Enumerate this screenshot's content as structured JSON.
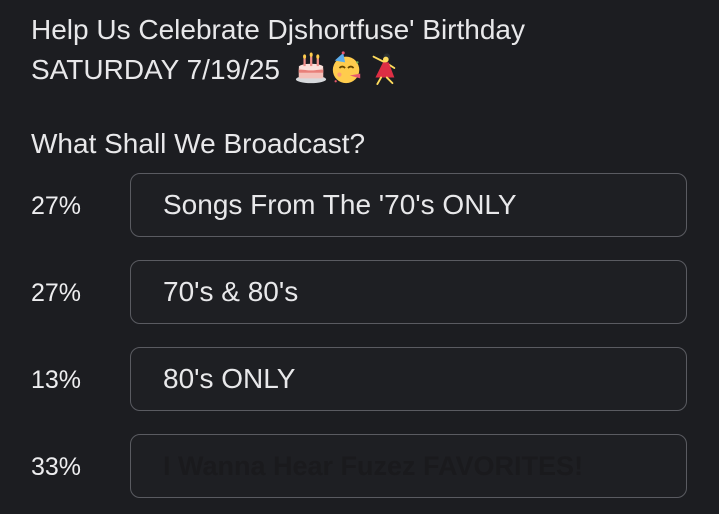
{
  "post": {
    "title_line1": "Help Us Celebrate Djshortfuse' Birthday",
    "title_line2": "SATURDAY 7/19/25",
    "emojis": [
      "birthday-cake",
      "partying-face",
      "dancer"
    ]
  },
  "poll": {
    "question": "What Shall We Broadcast?",
    "options": [
      {
        "percent": "27%",
        "label": "Songs From The '70's ONLY"
      },
      {
        "percent": "27%",
        "label": "70's & 80's"
      },
      {
        "percent": "13%",
        "label": "80's ONLY"
      },
      {
        "percent": "33%",
        "label": "I Wanna Hear Fuzez FAVORITES!"
      }
    ]
  },
  "colors": {
    "background": "#1c1d21",
    "text": "#e8e8ea",
    "border": "#5a5b61"
  }
}
